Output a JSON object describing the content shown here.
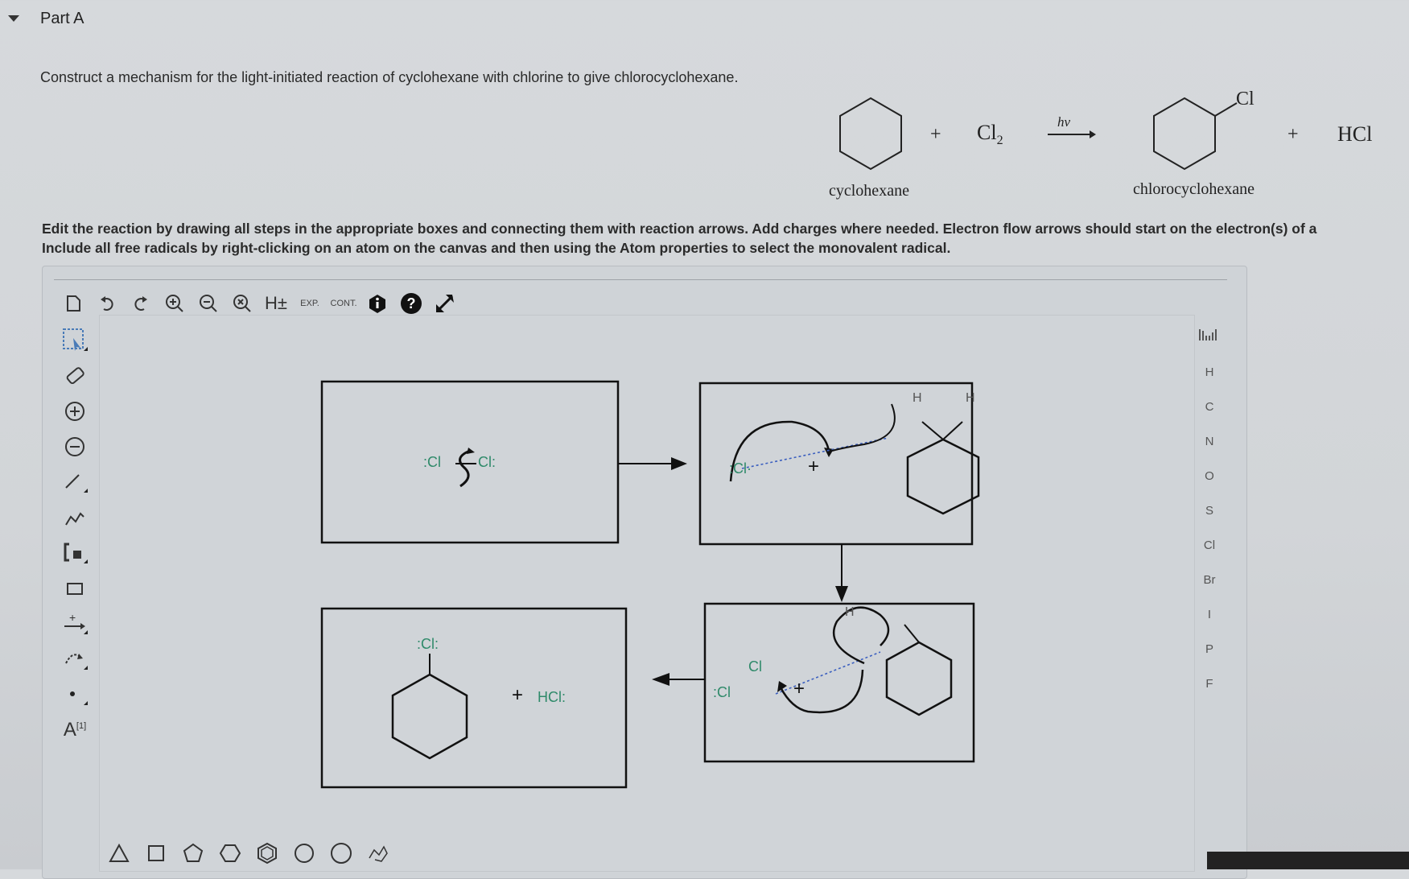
{
  "part": {
    "title": "Part A"
  },
  "prompt": "Construct a mechanism for the light-initiated reaction of cyclohexane with chlorine to give chlorocyclohexane.",
  "reaction": {
    "plus1": "+",
    "reagent": "Cl",
    "reagent_subscript": "2",
    "condition": "hv",
    "product_substituent": "Cl",
    "plus2": "+",
    "byproduct": "HCl",
    "reactant_label": "cyclohexane",
    "product_label": "chlorocyclohexane"
  },
  "instructions": {
    "line1": "Edit the reaction by drawing all steps in the appropriate boxes and connecting them with reaction arrows. Add charges where needed. Electron flow arrows should start on the electron(s) of a",
    "line2": "Include all free radicals by right-clicking on an atom on the canvas and then using the Atom properties to select the monovalent radical."
  },
  "toolbar": {
    "h_label": "H±",
    "exp_label": "EXP.",
    "cont_label": "CONT."
  },
  "lefttools": {
    "atom_label": "A",
    "atom_sup": "[1]"
  },
  "elements": [
    "H",
    "C",
    "N",
    "O",
    "S",
    "Cl",
    "Br",
    "I",
    "P",
    "F"
  ],
  "canvas": {
    "box1": {
      "left_cl": ":Cl",
      "right_cl": "Cl:"
    },
    "box2": {
      "cl": ":Cl·",
      "plus": "+",
      "h1": "H",
      "h2": "H"
    },
    "box3": {
      "cl_left": ":Cl",
      "cl_mid": "Cl",
      "plus": "+",
      "h": "H"
    },
    "box4": {
      "cl": ":Cl:",
      "plus": "+",
      "hcl": "HCl:"
    }
  }
}
